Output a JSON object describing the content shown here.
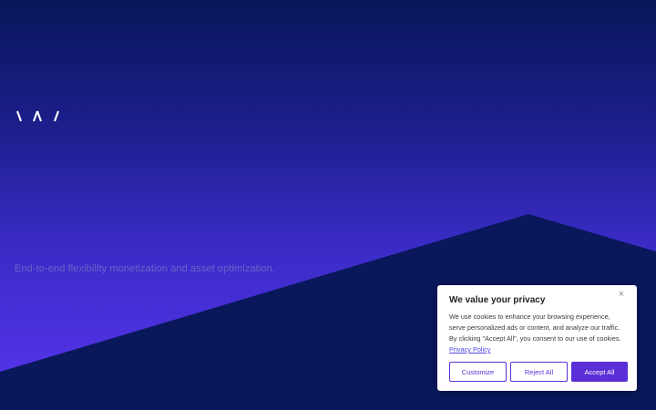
{
  "brand": {
    "logo_icon": "wavy-lines-logo-icon"
  },
  "hero": {
    "tagline": "End-to-end flexibility monetization and asset optimization."
  },
  "cookie_banner": {
    "title": "We value your privacy",
    "body": "We use cookies to enhance your browsing experience, serve personalized ads or content, and analyze our traffic. By clicking \"Accept All\", you consent to our use of cookies.",
    "privacy_link": "Privacy Policy",
    "close_icon": "close-icon",
    "close_glyph": "×",
    "buttons": {
      "customize": "Customize",
      "reject": "Reject All",
      "accept": "Accept All"
    }
  },
  "colors": {
    "background_top": "#07175a",
    "background_bottom": "#5a35f0",
    "dark_shape": "#08185a",
    "accent": "#5b2fd8",
    "tagline": "#6a63c9"
  }
}
